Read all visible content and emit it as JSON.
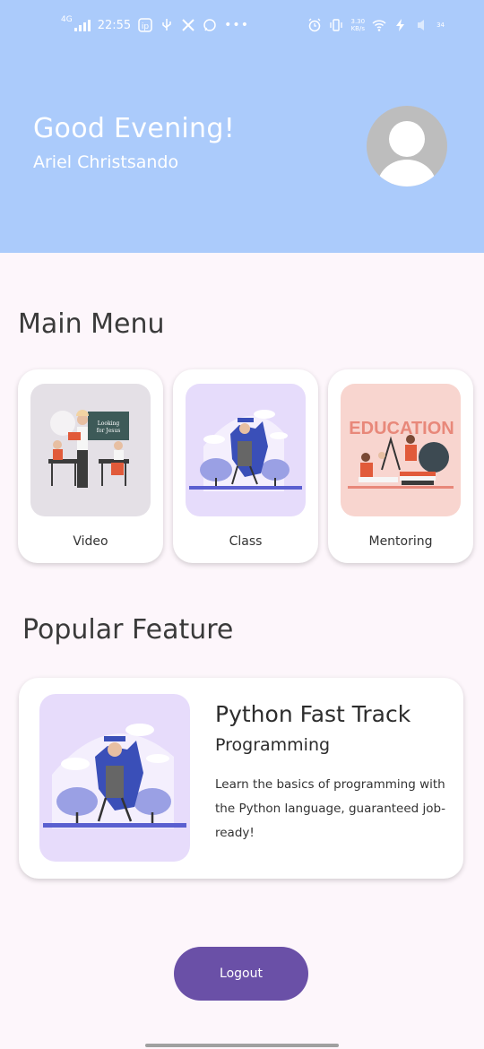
{
  "status_bar": {
    "network": "4G",
    "time": "22:55",
    "speed": "3.30\nKB/s",
    "battery": "34"
  },
  "header": {
    "greeting": "Good Evening!",
    "username": "Ariel Christsando",
    "background_color": "#abcbfb"
  },
  "main_menu": {
    "title": "Main Menu",
    "items": [
      {
        "label": "Video",
        "thumb_color": "#e4e0e6"
      },
      {
        "label": "Class",
        "thumb_color": "#e6dcfb"
      },
      {
        "label": "Mentoring",
        "thumb_color": "#f8d5cf"
      }
    ],
    "education_text": "EDUCATION"
  },
  "popular_feature": {
    "title": "Popular Feature",
    "card": {
      "title": "Python Fast Track",
      "subtitle": "Programming",
      "description": "Learn the basics of programming with the Python language, guaranteed job-ready!"
    }
  },
  "logout": {
    "label": "Logout",
    "color": "#6a50a7"
  }
}
